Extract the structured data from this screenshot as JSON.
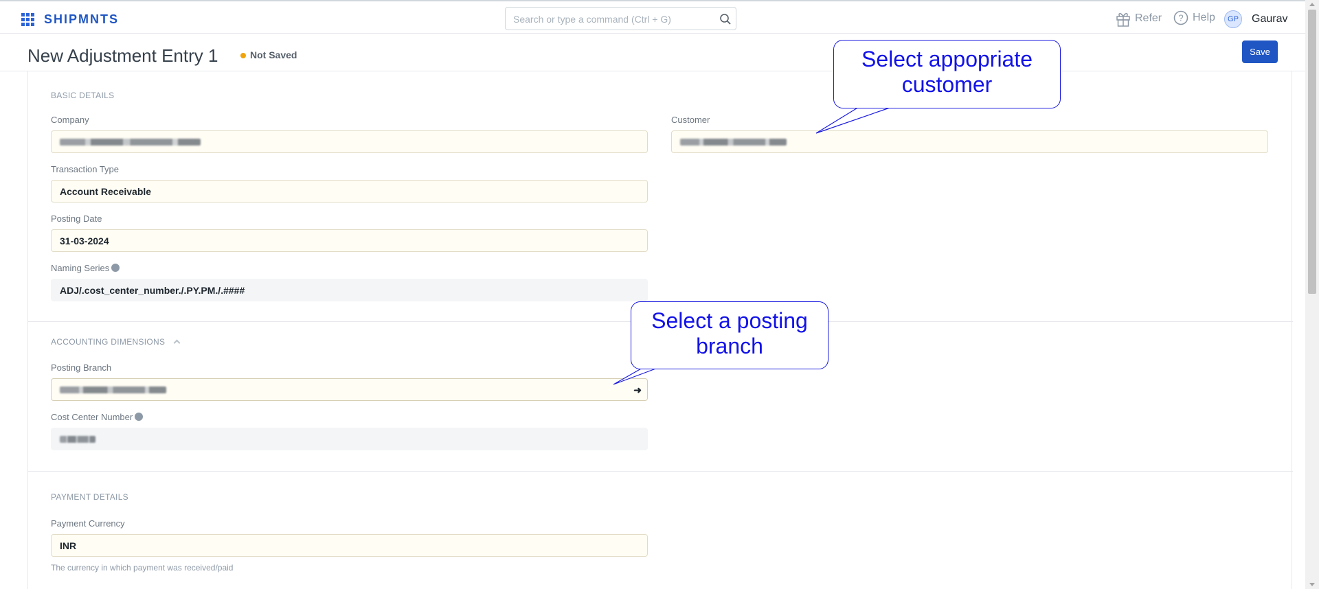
{
  "navbar": {
    "brand": "SHIPMNTS",
    "search_placeholder": "Search or type a command (Ctrl + G)",
    "refer_label": "Refer",
    "help_label": "Help",
    "user_initials": "GP",
    "user_name": "Gaurav"
  },
  "page": {
    "title": "New Adjustment Entry 1",
    "status": "Not Saved",
    "save_label": "Save"
  },
  "sections": {
    "basic": {
      "title": "BASIC DETAILS",
      "company_label": "Company",
      "customer_label": "Customer",
      "transaction_type_label": "Transaction Type",
      "transaction_type_value": "Account Receivable",
      "posting_date_label": "Posting Date",
      "posting_date_value": "31-03-2024",
      "naming_series_label": "Naming Series",
      "naming_series_value": "ADJ/.cost_center_number./.PY.PM./.####"
    },
    "accounting": {
      "title": "ACCOUNTING DIMENSIONS",
      "posting_branch_label": "Posting Branch",
      "cost_center_label": "Cost Center Number"
    },
    "payment": {
      "title": "PAYMENT DETAILS",
      "currency_label": "Payment Currency",
      "currency_value": "INR",
      "currency_help": "The currency in which payment was received/paid"
    }
  },
  "callouts": {
    "customer": "Select appopriate customer",
    "branch": "Select a posting branch"
  },
  "colors": {
    "accent": "#1f56c4",
    "callout": "#1212e8",
    "status_dot": "#f0a30a"
  }
}
